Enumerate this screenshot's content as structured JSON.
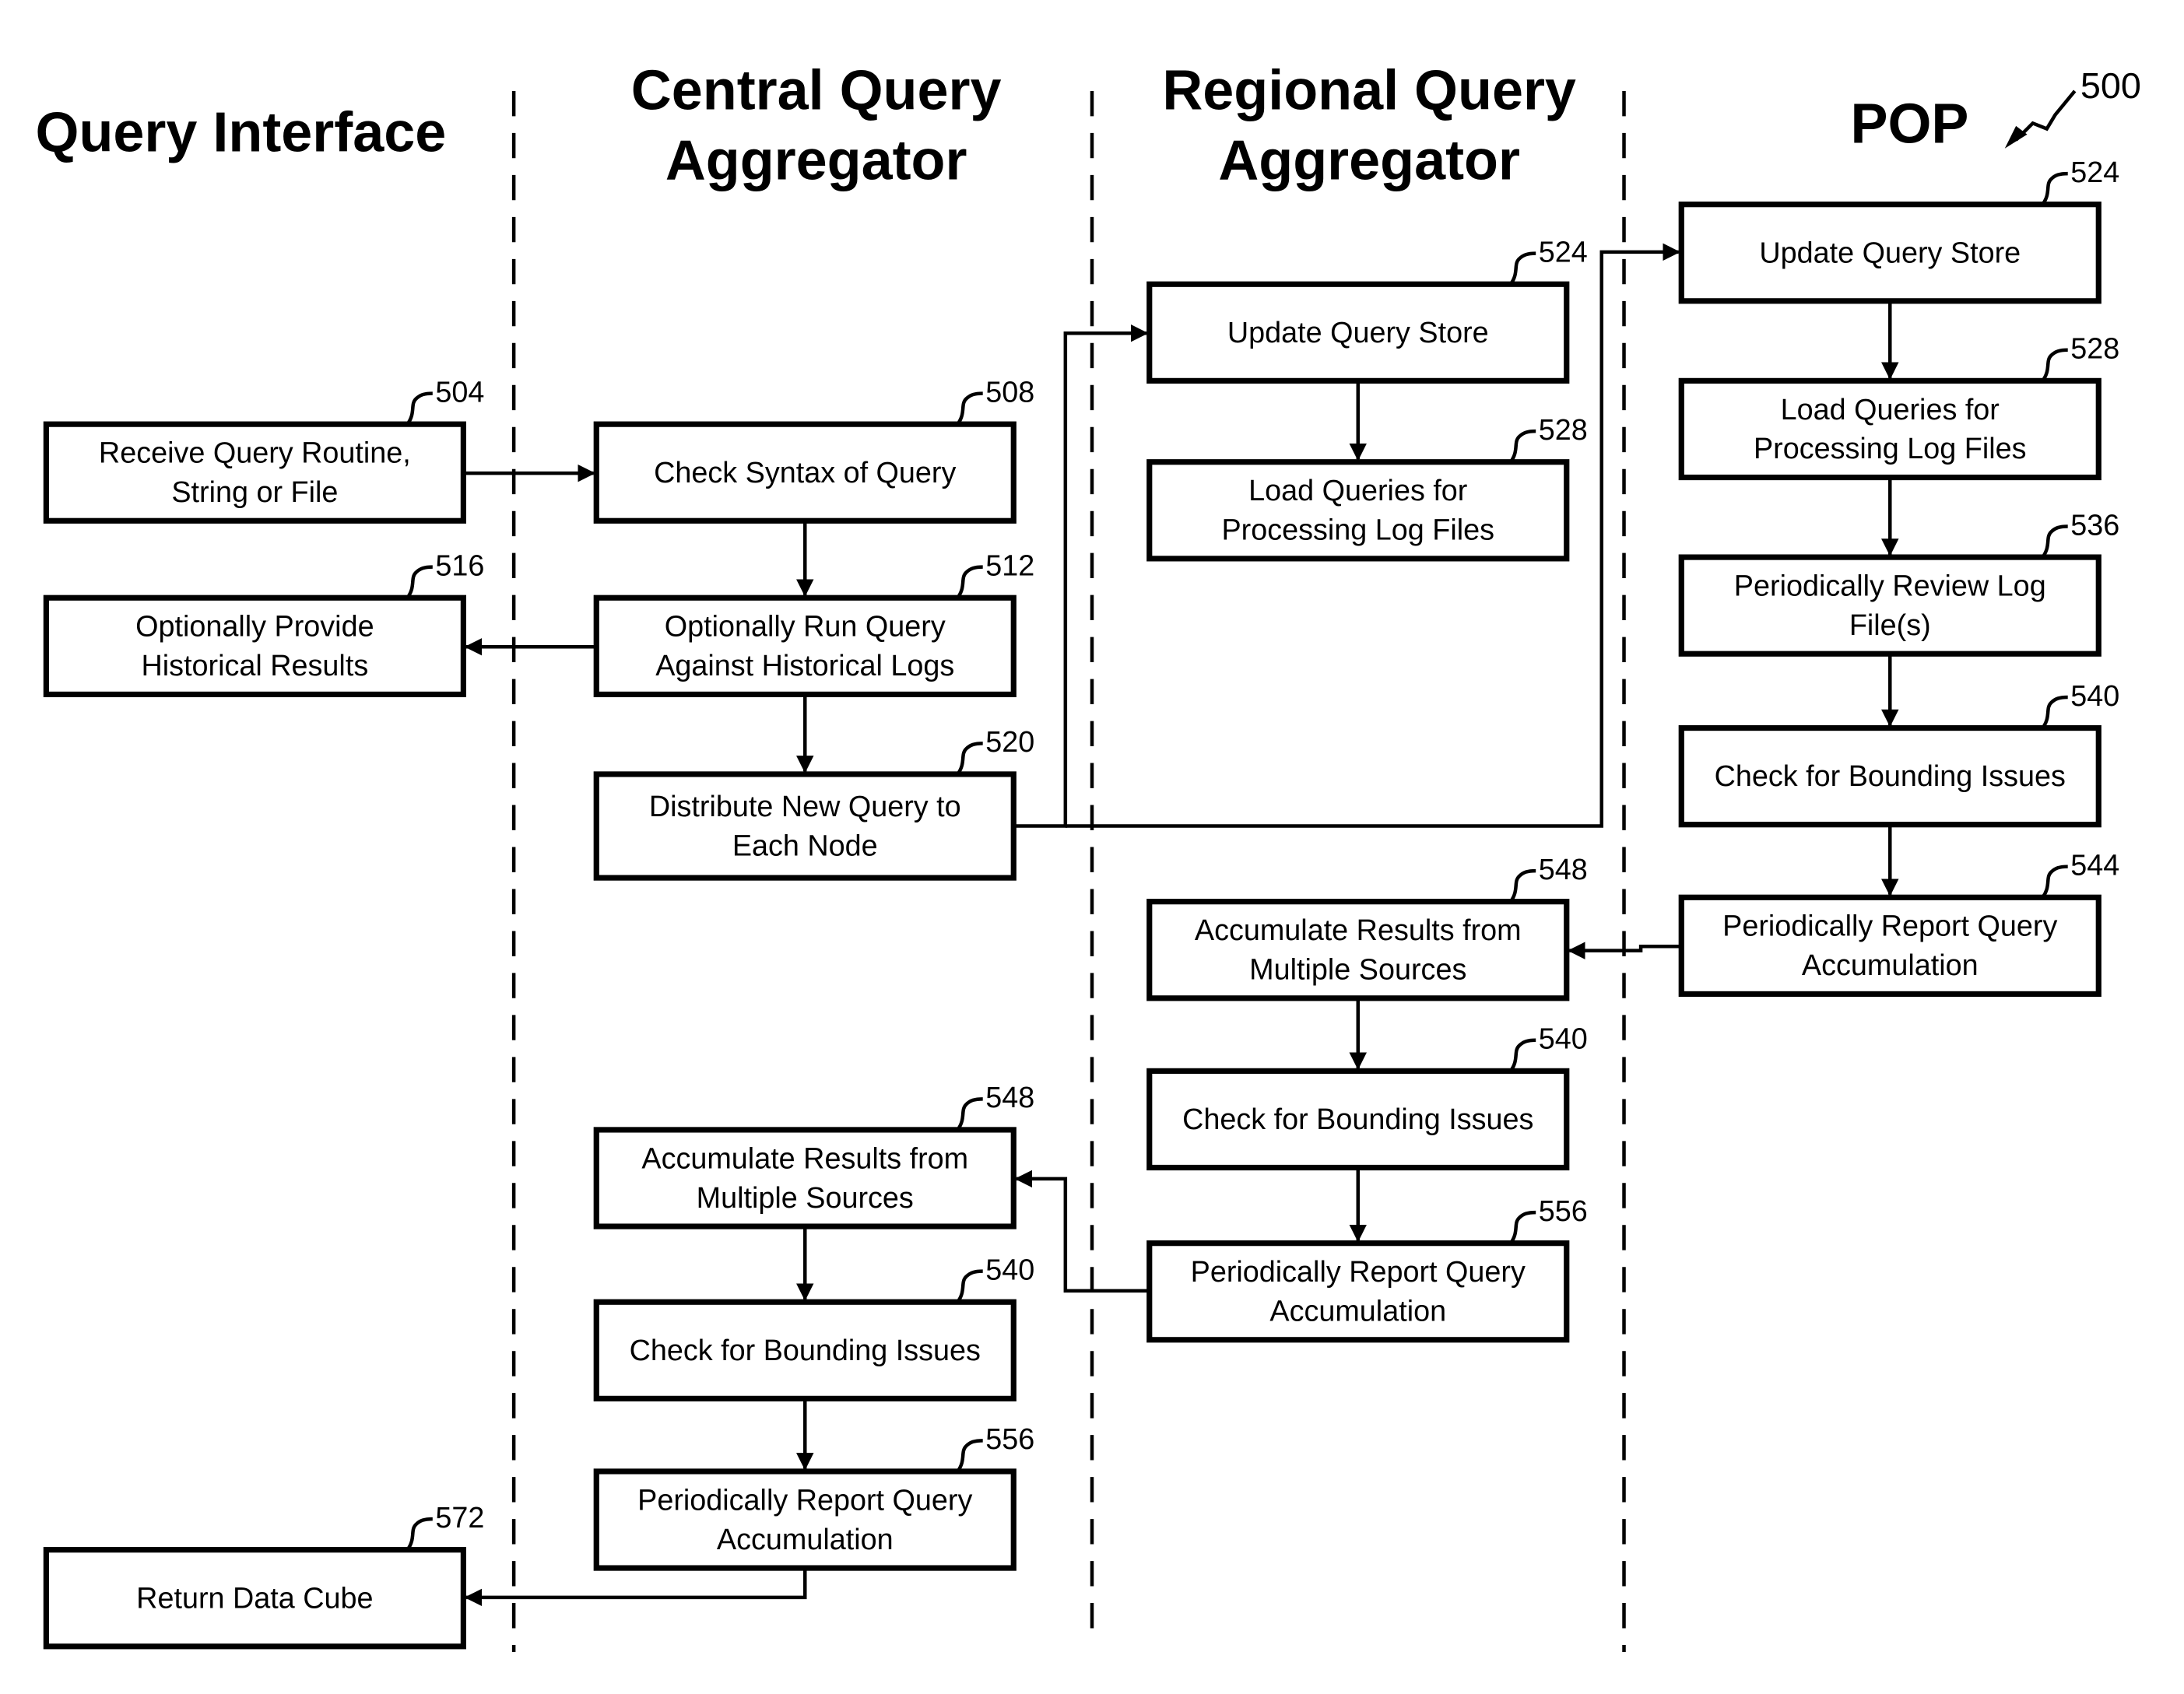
{
  "figure": {
    "ref": "500"
  },
  "lanes": [
    {
      "id": "query-interface",
      "title_lines": [
        "Query Interface"
      ]
    },
    {
      "id": "central-query-aggregator",
      "title_lines": [
        "Central Query",
        "Aggregator"
      ]
    },
    {
      "id": "regional-query-aggregator",
      "title_lines": [
        "Regional Query",
        "Aggregator"
      ]
    },
    {
      "id": "pop",
      "title_lines": [
        "POP"
      ]
    }
  ],
  "boxes": [
    {
      "id": "qi-504",
      "lane": "query-interface",
      "ref": "504",
      "lines": [
        "Receive Query Routine,",
        "String or File"
      ]
    },
    {
      "id": "qi-516",
      "lane": "query-interface",
      "ref": "516",
      "lines": [
        "Optionally Provide",
        "Historical Results"
      ]
    },
    {
      "id": "qi-572",
      "lane": "query-interface",
      "ref": "572",
      "lines": [
        "Return Data Cube"
      ]
    },
    {
      "id": "cqa-508",
      "lane": "central-query-aggregator",
      "ref": "508",
      "lines": [
        "Check Syntax of Query"
      ]
    },
    {
      "id": "cqa-512",
      "lane": "central-query-aggregator",
      "ref": "512",
      "lines": [
        "Optionally Run Query",
        "Against Historical Logs"
      ]
    },
    {
      "id": "cqa-520",
      "lane": "central-query-aggregator",
      "ref": "520",
      "lines": [
        "Distribute New Query to",
        "Each Node"
      ]
    },
    {
      "id": "cqa-548",
      "lane": "central-query-aggregator",
      "ref": "548",
      "lines": [
        "Accumulate Results from",
        "Multiple Sources"
      ]
    },
    {
      "id": "cqa-540",
      "lane": "central-query-aggregator",
      "ref": "540",
      "lines": [
        "Check for Bounding Issues"
      ]
    },
    {
      "id": "cqa-556",
      "lane": "central-query-aggregator",
      "ref": "556",
      "lines": [
        "Periodically Report Query",
        "Accumulation"
      ]
    },
    {
      "id": "rqa-524",
      "lane": "regional-query-aggregator",
      "ref": "524",
      "lines": [
        "Update Query Store"
      ]
    },
    {
      "id": "rqa-528",
      "lane": "regional-query-aggregator",
      "ref": "528",
      "lines": [
        "Load Queries for",
        "Processing Log Files"
      ]
    },
    {
      "id": "rqa-548",
      "lane": "regional-query-aggregator",
      "ref": "548",
      "lines": [
        "Accumulate Results from",
        "Multiple Sources"
      ]
    },
    {
      "id": "rqa-540",
      "lane": "regional-query-aggregator",
      "ref": "540",
      "lines": [
        "Check for Bounding Issues"
      ]
    },
    {
      "id": "rqa-556",
      "lane": "regional-query-aggregator",
      "ref": "556",
      "lines": [
        "Periodically Report Query",
        "Accumulation"
      ]
    },
    {
      "id": "pop-524",
      "lane": "pop",
      "ref": "524",
      "lines": [
        "Update Query Store"
      ]
    },
    {
      "id": "pop-528",
      "lane": "pop",
      "ref": "528",
      "lines": [
        "Load Queries for",
        "Processing Log Files"
      ]
    },
    {
      "id": "pop-536",
      "lane": "pop",
      "ref": "536",
      "lines": [
        "Periodically Review Log",
        "File(s)"
      ]
    },
    {
      "id": "pop-540",
      "lane": "pop",
      "ref": "540",
      "lines": [
        "Check for Bounding Issues"
      ]
    },
    {
      "id": "pop-544",
      "lane": "pop",
      "ref": "544",
      "lines": [
        "Periodically Report Query",
        "Accumulation"
      ]
    }
  ],
  "connections": [
    {
      "from": "qi-504",
      "to": "cqa-508"
    },
    {
      "from": "cqa-508",
      "to": "cqa-512"
    },
    {
      "from": "cqa-512",
      "to": "qi-516"
    },
    {
      "from": "cqa-512",
      "to": "cqa-520"
    },
    {
      "from": "cqa-520",
      "to": "rqa-524"
    },
    {
      "from": "cqa-520",
      "to": "pop-524"
    },
    {
      "from": "rqa-524",
      "to": "rqa-528"
    },
    {
      "from": "pop-524",
      "to": "pop-528"
    },
    {
      "from": "pop-528",
      "to": "pop-536"
    },
    {
      "from": "pop-536",
      "to": "pop-540"
    },
    {
      "from": "pop-540",
      "to": "pop-544"
    },
    {
      "from": "pop-544",
      "to": "rqa-548"
    },
    {
      "from": "rqa-548",
      "to": "rqa-540"
    },
    {
      "from": "rqa-540",
      "to": "rqa-556"
    },
    {
      "from": "rqa-556",
      "to": "cqa-548"
    },
    {
      "from": "cqa-548",
      "to": "cqa-540"
    },
    {
      "from": "cqa-540",
      "to": "cqa-556"
    },
    {
      "from": "cqa-556",
      "to": "qi-572"
    }
  ]
}
